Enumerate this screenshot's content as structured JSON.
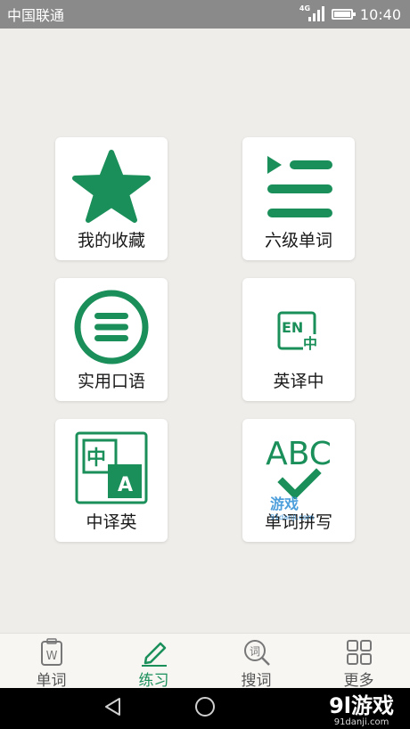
{
  "status_bar": {
    "carrier": "中国联通",
    "network": "4G",
    "time": "10:40"
  },
  "grid": [
    {
      "label": "我的收藏",
      "icon": "star-icon"
    },
    {
      "label": "六级单词",
      "icon": "list-play-icon"
    },
    {
      "label": "实用口语",
      "icon": "menu-circle-icon"
    },
    {
      "label": "英译中",
      "icon": "en-to-cn-icon",
      "icon_text": [
        "EN",
        "中"
      ]
    },
    {
      "label": "中译英",
      "icon": "cn-to-en-icon",
      "icon_text": [
        "中",
        "A"
      ]
    },
    {
      "label": "单词拼写",
      "icon": "abc-check-icon",
      "icon_text": [
        "ABC"
      ]
    }
  ],
  "watermark": {
    "text": "游戏",
    "sub": "91danji.com"
  },
  "tabs": [
    {
      "label": "单词",
      "icon": "word-book-icon",
      "icon_text": "W",
      "active": false
    },
    {
      "label": "练习",
      "icon": "pencil-icon",
      "active": true
    },
    {
      "label": "搜词",
      "icon": "search-word-icon",
      "icon_text": "词",
      "active": false
    },
    {
      "label": "更多",
      "icon": "grid-icon",
      "active": false
    }
  ],
  "corner_logo": {
    "text": "9l游戏",
    "sub": "91danji.com"
  },
  "colors": {
    "accent": "#1a8f5a",
    "background": "#efedea",
    "status_bar": "#8a8a8a"
  }
}
